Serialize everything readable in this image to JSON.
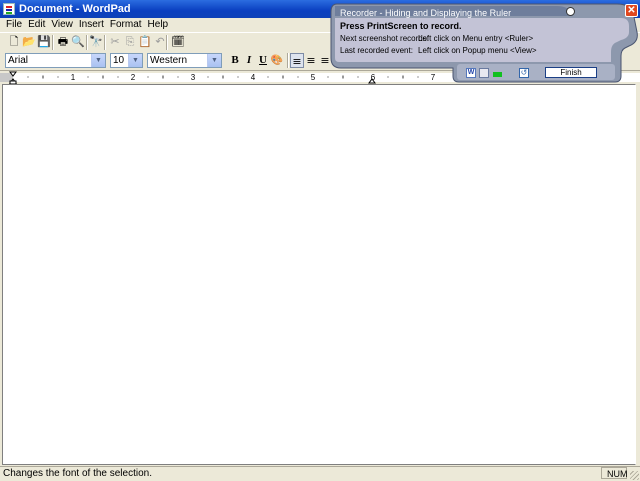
{
  "window": {
    "title": "Document - WordPad"
  },
  "menu": [
    "File",
    "Edit",
    "View",
    "Insert",
    "Format",
    "Help"
  ],
  "toolbar": {
    "new_glyph": "🗋",
    "open_glyph": "📂",
    "save_glyph": "💾",
    "print_glyph": "🖶",
    "preview_glyph": "🔍",
    "find_glyph": "🔭",
    "cut_glyph": "✂",
    "copy_glyph": "⎘",
    "paste_glyph": "📋",
    "undo_glyph": "↶",
    "datetime_glyph": "🗓"
  },
  "format": {
    "font": "Arial",
    "size": "10",
    "script": "Western",
    "bold": "B",
    "italic": "I",
    "underline": "U",
    "color_glyph": "🎨",
    "align_left_glyph": "≡",
    "align_center_glyph": "≡",
    "align_right_glyph": "≡"
  },
  "ruler": {
    "labels": [
      "1",
      "2",
      "3",
      "4",
      "5",
      "6",
      "7"
    ]
  },
  "status": {
    "message": "Changes the font of the selection.",
    "num": "NUM"
  },
  "recorder": {
    "title": "Recorder - Hiding and Displaying the Ruler",
    "instruction": "Press PrintScreen to record.",
    "next_label": "Next screenshot records:",
    "next_value": "Left click on Menu entry <Ruler>",
    "last_label": "Last recorded event:",
    "last_value": "Left click on Popup menu <View>",
    "finish_label": "Finish",
    "close_glyph": "✕"
  },
  "colors": {
    "titlebar": "#0a3fc0",
    "recorder_body": "#c3c3d6",
    "recorder_title": "#6f7e9c",
    "status_green": "#10c020"
  }
}
